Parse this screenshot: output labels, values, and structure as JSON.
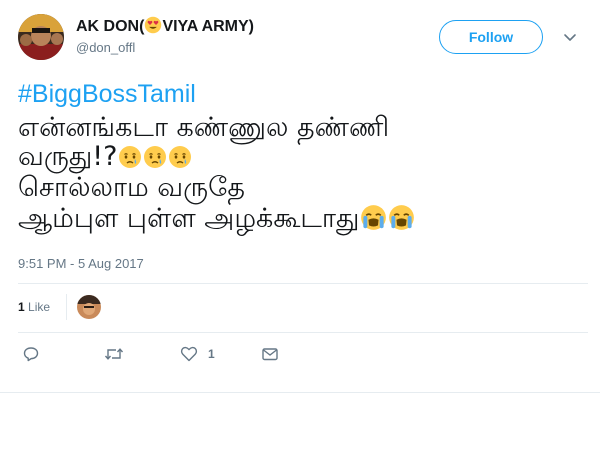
{
  "author": {
    "name_prefix": "AK DON(",
    "name_suffix": "VIYA ARMY)",
    "handle": "@don_offl",
    "emoji": "heart-eyes-emoji"
  },
  "follow_button": {
    "label": "Follow"
  },
  "tweet": {
    "hashtag": "#BiggBossTamil",
    "line1": "என்னங்கடா கண்ணுல தண்ணி",
    "line2": "வருது!?",
    "line3": "சொல்லாம வருதே",
    "line4": "ஆம்புள புள்ள அழக்கூடாது",
    "line2_emojis": [
      "crying-emoji",
      "crying-emoji",
      "crying-emoji"
    ],
    "line4_emojis": [
      "loudly-crying-emoji",
      "loudly-crying-emoji"
    ]
  },
  "timestamp": "9:51 PM - 5 Aug 2017",
  "likes": {
    "count": "1",
    "label": "Like"
  },
  "actions": {
    "like_count": "1"
  },
  "colors": {
    "accent": "#1da1f2",
    "secondary_text": "#657786",
    "divider": "#e6ecf0"
  }
}
